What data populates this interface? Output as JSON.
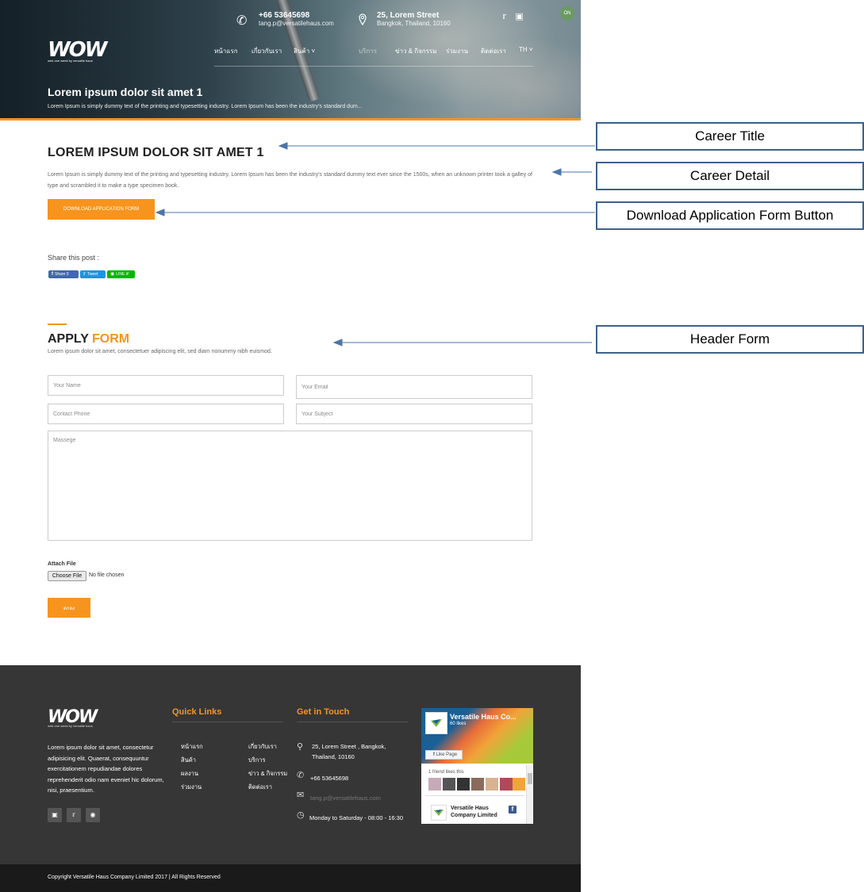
{
  "header": {
    "phone": "+66 53645698",
    "email": "tang.p@versatilehaus.com",
    "address_line1": "25, Lorem Street",
    "address_line2": "Bangkok, Thailand, 10160",
    "lang_badge": "ON",
    "nav": [
      "หน้าแรก",
      "เกี่ยวกับเรา",
      "สินค้า",
      "บริการ",
      "ข่าว & กิจกรรม",
      "ร่วมงาน",
      "ติดต่อเรา",
      "TH"
    ],
    "logo_text": "WOW",
    "logo_tagline": "web one week by versatile haus",
    "hero_title": "Lorem ipsum dolor sit amet 1",
    "hero_subtitle": "Lorem Ipsum is simply dummy text of the printing and typesetting industry. Lorem Ipsum has been the industry's standard dum..."
  },
  "career": {
    "title": "LOREM IPSUM DOLOR SIT AMET 1",
    "detail": "Lorem Ipsum is simply dummy text of the printing and typesetting industry. Lorem Ipsum has been the industry's standard dummy text ever since the 1500s, when an unknown printer took a galley of type and scrambled it to make a type specimen book.",
    "download_label": "DOWNLOAD APPLICATION FORM",
    "share_label": "Share this post :",
    "share_buttons": [
      "Share 0",
      "Tweet",
      "LINE it!"
    ]
  },
  "form": {
    "title_a": "APPLY ",
    "title_b": "FORM",
    "subtitle": "Lorem ipsum dolor sit amet, consectetuer adipiscing elit, sed diam nonummy nibh euismod.",
    "name_placeholder": "Your Name",
    "email_placeholder": "Your Email",
    "phone_placeholder": "Contact Phone",
    "subject_placeholder": "Your Subject",
    "message_placeholder": "Massege",
    "attach_label": "Attach File",
    "choose_file_label": "Choose File",
    "no_file_text": "No file chosen",
    "submit_label": "ตกลง"
  },
  "footer": {
    "logo_text": "WOW",
    "logo_tagline": "web one week by versatile haus",
    "about": "Lorem ipsum dolor sit amet, consectetur adipisicing elit. Quaerat, consequuntur exercitationem repudiandae dolores reprehenderit odio nam eveniet hic dolorum, nisi, praesentium.",
    "quick_links_title": "Quick Links",
    "quick_links": [
      "หน้าแรก",
      "เกี่ยวกับเรา",
      "สินค้า",
      "บริการ",
      "ผลงาน",
      "ข่าว & กิจกรรม",
      "ร่วมงาน",
      "ติดต่อเรา"
    ],
    "touch_title": "Get in Touch",
    "address_line1": "25, Lorem Street , Bangkok,",
    "address_line2": "Thailand, 10160",
    "phone": "+66 53645698",
    "email": "tang.p@versatilehaus.com",
    "hours": "Monday to Saturday - 08:00 - 16:30",
    "fb_page_name": "Versatile Haus Co...",
    "fb_likes": "60 likes",
    "fb_like_button": "Like Page",
    "fb_friend_text": "1 friend likes this",
    "fb_post_name": "Versatile Haus Company Limited",
    "copyright": "Copyright Versatile Haus Company Limited 2017 | All Rights Reserved"
  },
  "annotations": {
    "career_title": "Career Title",
    "career_detail": "Career Detail",
    "download_button": "Download Application Form Button",
    "header_form": "Header Form"
  },
  "colors": {
    "accent": "#f7941d",
    "footer_bg": "#363636",
    "copyright_bg": "#1a1a1a",
    "annotation_border": "#3f6189",
    "facebook_blue": "#3b5998"
  }
}
